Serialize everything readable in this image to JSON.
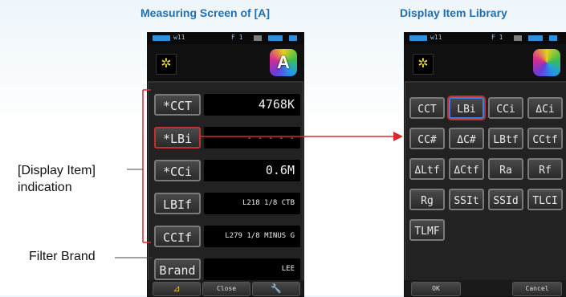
{
  "titles": {
    "left": "Measuring Screen of [A]",
    "right": "Display Item Library"
  },
  "measuring_screen": {
    "status": {
      "left": "w11",
      "mid": "F 1"
    },
    "header_icon": "sun-icon",
    "logo_letter": "A",
    "rows": [
      {
        "label": "*CCT",
        "value": "4768K"
      },
      {
        "label": "*LBi",
        "value": "- - - - -"
      },
      {
        "label": "*CCi",
        "value": "0.6M"
      },
      {
        "label": "LBIf",
        "value": "L218 1/8 CTB"
      },
      {
        "label": "CCIf",
        "value": "L279 1/8 MINUS G"
      },
      {
        "label": "Brand",
        "value": "LEE"
      }
    ],
    "footer": {
      "left_icon": "delta-icon",
      "close": "Close",
      "right_icon": "wrench-icon"
    }
  },
  "library_screen": {
    "status": {
      "left": "w11",
      "mid": "F 1"
    },
    "header_icon": "sun-icon",
    "items": [
      "CCT",
      "LBi",
      "CCi",
      "ΔCi",
      "CC#",
      "ΔC#",
      "LBtf",
      "CCtf",
      "ΔLtf",
      "ΔCtf",
      "Ra",
      "Rf",
      "Rg",
      "SSIt",
      "SSId",
      "TLCI",
      "TLMF"
    ],
    "footer": {
      "ok": "OK",
      "cancel": "Cancel"
    }
  },
  "annotations": {
    "display_item": "[Display Item]\nindication",
    "display_item_line1": "[Display Item]",
    "display_item_line2": "indication",
    "filter_brand": "Filter Brand"
  },
  "colors": {
    "title": "#1f6fb0",
    "bracket": "#d62b2b",
    "highlight": "#c43030"
  }
}
